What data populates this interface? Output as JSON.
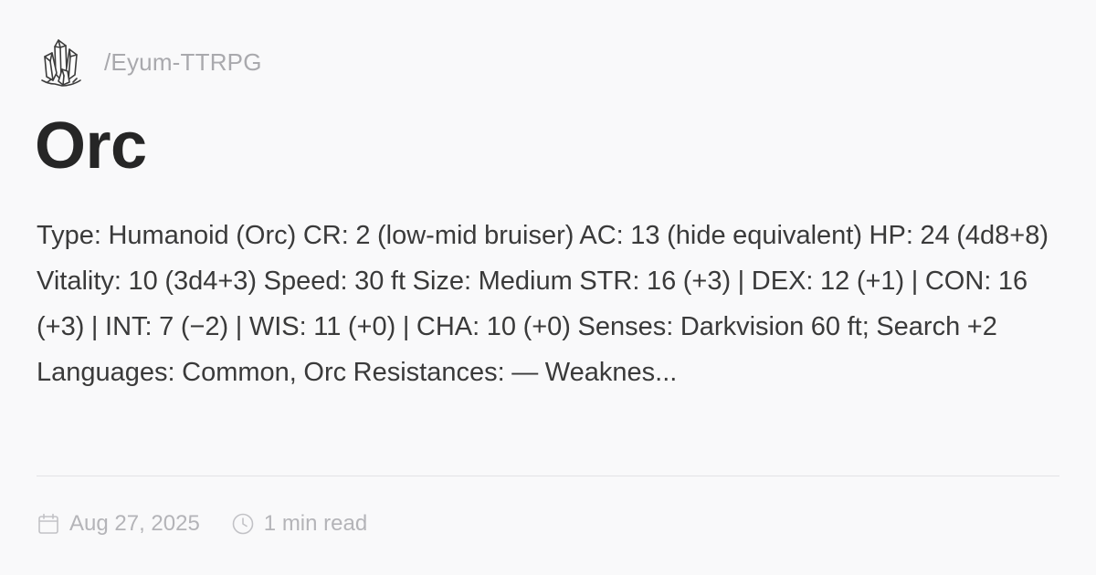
{
  "site": {
    "path": "/Eyum-TTRPG",
    "logo_icon": "crystal-icon"
  },
  "post": {
    "title": "Orc",
    "excerpt": "Type: Humanoid (Orc) CR: 2 (low-mid bruiser) AC: 13 (hide equivalent) HP: 24 (4d8+8) Vitality: 10 (3d4+3) Speed: 30 ft Size: Medium STR: 16 (+3) | DEX: 12 (+1) | CON: 16 (+3) | INT: 7 (−2) | WIS: 11 (+0) | CHA: 10 (+0) Senses: Darkvision 60 ft; Search +2 Languages: Common, Orc Resistances: — Weaknes...",
    "date": "Aug 27, 2025",
    "date_icon": "calendar-icon",
    "read_time": "1 min read",
    "read_time_icon": "clock-icon"
  },
  "colors": {
    "background": "#f9f9fa",
    "title": "#262626",
    "body_text": "#3a3a3a",
    "muted": "#b4b4b8",
    "divider": "#e3e3e6"
  }
}
